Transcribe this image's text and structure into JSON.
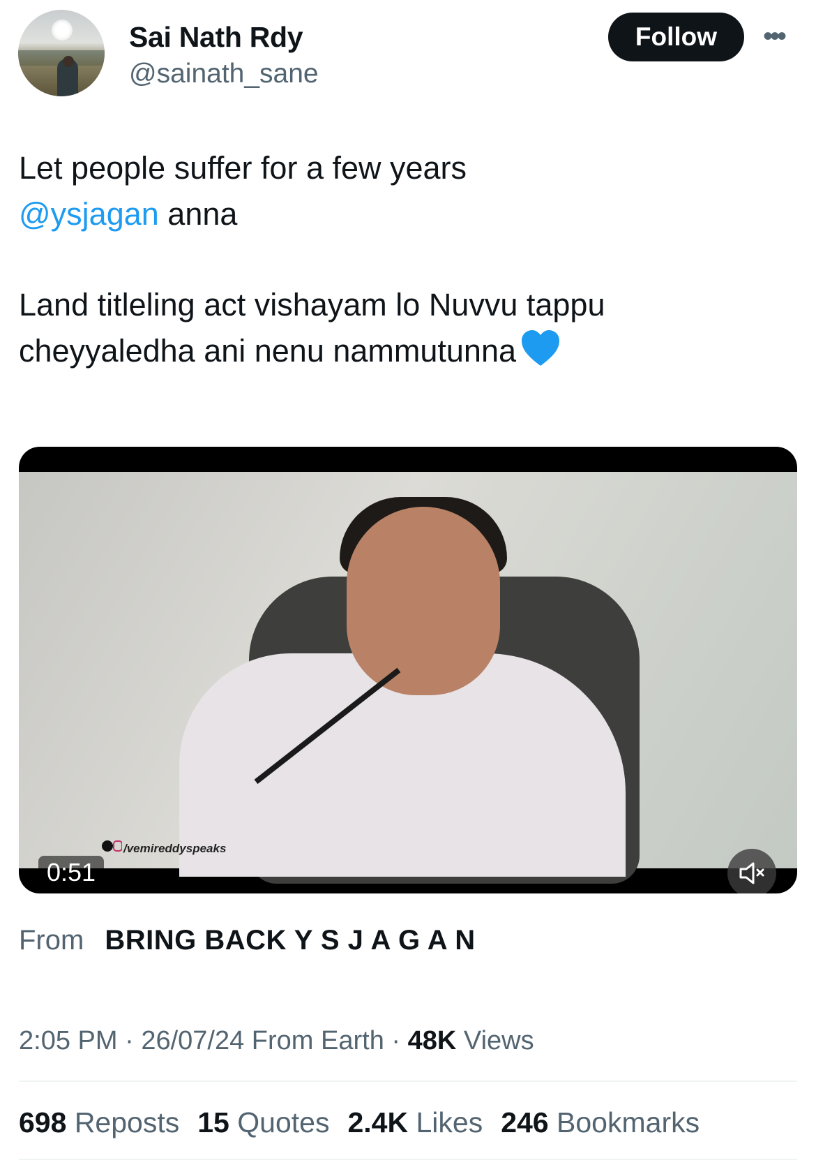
{
  "author": {
    "name": "Sai Nath Rdy",
    "handle": "@sainath_sane"
  },
  "follow_label": "Follow",
  "more_label": "•••",
  "tweet": {
    "line1": "Let people suffer for a few years",
    "mention": "@ysjagan",
    "line2_rest": " anna",
    "line3": "Land titleling act vishayam lo Nuvvu tappu",
    "line4": "cheyyaledha ani nenu nammutunna",
    "emoji_icon": "blue-heart"
  },
  "video": {
    "duration": "0:51",
    "watermark": "/vemireddyspeaks",
    "mute_icon": "muted-speaker-icon"
  },
  "source": {
    "label": "From",
    "name": "BRING BACK Y S J A G A N"
  },
  "meta": {
    "time": "2:05 PM",
    "date": "26/07/24",
    "location": "From Earth",
    "views_count": "48K",
    "views_label": "Views",
    "separator": "·"
  },
  "stats": {
    "reposts_count": "698",
    "reposts_label": "Reposts",
    "quotes_count": "15",
    "quotes_label": "Quotes",
    "likes_count": "2.4K",
    "likes_label": "Likes",
    "bookmarks_count": "246",
    "bookmarks_label": "Bookmarks"
  },
  "colors": {
    "text": "#0f1419",
    "secondary": "#536471",
    "link": "#1d9bf0",
    "heart": "#1d9bf0"
  }
}
